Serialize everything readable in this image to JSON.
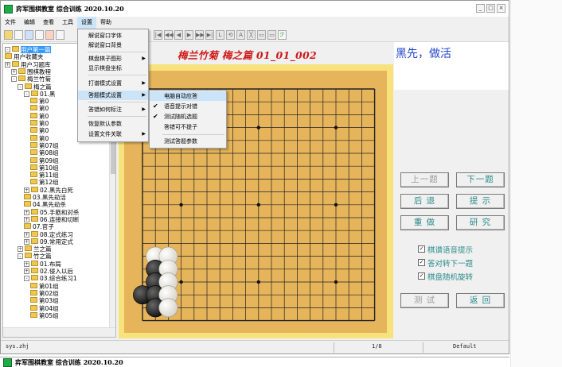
{
  "window": {
    "title": "弈军围棋教室 综合训练 2020.10.20",
    "controls": [
      "_",
      "□",
      "×"
    ]
  },
  "menubar": {
    "items": [
      "文件",
      "编辑",
      "查看",
      "工具",
      "设置",
      "帮助"
    ],
    "active_index": 4
  },
  "settings_menu": {
    "items": [
      {
        "label": "解说窗口字体",
        "submenu": false
      },
      {
        "label": "解说窗口背景",
        "submenu": false
      },
      {
        "label": "棋盘棋子图形",
        "submenu": true
      },
      {
        "label": "显示棋盘坐标",
        "submenu": false
      },
      {
        "label": "打谱模式设置",
        "submenu": true
      },
      {
        "label": "答题模式设置",
        "submenu": true
      },
      {
        "label": "答错如何标注",
        "submenu": true
      },
      {
        "label": "恢复默认参数",
        "submenu": false
      },
      {
        "label": "设置文件关联",
        "submenu": true
      }
    ],
    "highlighted_index": 5
  },
  "answer_submenu": {
    "items": [
      {
        "label": "电脑自动应答",
        "checked": false
      },
      {
        "label": "语音提示对错",
        "checked": true
      },
      {
        "label": "测试随机选题",
        "checked": true
      },
      {
        "label": "答错可不提子",
        "checked": false
      },
      {
        "label": "测试答题参数",
        "checked": false
      }
    ],
    "highlighted_index": 0
  },
  "tree": {
    "items": [
      {
        "label": "用户第一篇",
        "selected": true
      },
      {
        "label": "用户收藏夹",
        "selected": false
      },
      {
        "label": "用户习题库",
        "selected": false
      },
      {
        "label": "围棋教程",
        "selected": false
      },
      {
        "label": "梅兰竹菊",
        "selected": false
      },
      {
        "label": "梅之篇",
        "selected": false
      },
      {
        "label": "01.黑",
        "selected": false
      },
      {
        "label": "第0",
        "selected": false
      },
      {
        "label": "第0",
        "selected": false
      },
      {
        "label": "第0",
        "selected": false
      },
      {
        "label": "第0",
        "selected": false
      },
      {
        "label": "第0",
        "selected": false
      },
      {
        "label": "第0",
        "selected": false
      },
      {
        "label": "第07组",
        "selected": false
      },
      {
        "label": "第08组",
        "selected": false
      },
      {
        "label": "第09组",
        "selected": false
      },
      {
        "label": "第10组",
        "selected": false
      },
      {
        "label": "第11组",
        "selected": false
      },
      {
        "label": "第12组",
        "selected": false
      },
      {
        "label": "02.黑先白死",
        "selected": false
      },
      {
        "label": "03.黑先劫活",
        "selected": false
      },
      {
        "label": "04.黑先劫杀",
        "selected": false
      },
      {
        "label": "05.手筋和对杀",
        "selected": false
      },
      {
        "label": "06.连接和切断",
        "selected": false
      },
      {
        "label": "07.官子",
        "selected": false
      },
      {
        "label": "08.定式练习",
        "selected": false
      },
      {
        "label": "09.常用定式",
        "selected": false
      },
      {
        "label": "兰之篇",
        "selected": false
      },
      {
        "label": "竹之篇",
        "selected": false
      },
      {
        "label": "01.布局",
        "selected": false
      },
      {
        "label": "02.侵入以后",
        "selected": false
      },
      {
        "label": "03.综合练习1",
        "selected": false
      },
      {
        "label": "第01组",
        "selected": false
      },
      {
        "label": "第02组",
        "selected": false
      },
      {
        "label": "第03组",
        "selected": false
      },
      {
        "label": "第04组",
        "selected": false
      },
      {
        "label": "第05组",
        "selected": false
      }
    ]
  },
  "problem": {
    "title": "梅兰竹菊 梅之篇 01_01_002",
    "status": "黑先，做活"
  },
  "stones": [
    {
      "col": 1,
      "row": 13,
      "color": "white"
    },
    {
      "col": 2,
      "row": 13,
      "color": "white"
    },
    {
      "col": 1,
      "row": 14,
      "color": "black"
    },
    {
      "col": 2,
      "row": 14,
      "color": "white"
    },
    {
      "col": 1,
      "row": 15,
      "color": "black"
    },
    {
      "col": 2,
      "row": 15,
      "color": "white"
    },
    {
      "col": 0,
      "row": 16,
      "color": "black"
    },
    {
      "col": 1,
      "row": 16,
      "color": "black"
    },
    {
      "col": 2,
      "row": 16,
      "color": "white"
    },
    {
      "col": 1,
      "row": 17,
      "color": "black"
    },
    {
      "col": 2,
      "row": 17,
      "color": "white"
    }
  ],
  "buttons": {
    "prev": "上一题",
    "next": "下一题",
    "back": "后 退",
    "hint": "提 示",
    "redo": "重 做",
    "study": "研 究",
    "test": "测 试",
    "return": "返 回"
  },
  "options": [
    {
      "label": "棋谱语音提示",
      "checked": true
    },
    {
      "label": "答对转下一题",
      "checked": true
    },
    {
      "label": "棋盘随机旋转",
      "checked": true
    }
  ],
  "statusbar": {
    "file": "sys.zhj",
    "page": "1/8",
    "style": "Default"
  },
  "second_window": {
    "title": "弈军围棋教室 综合训练 2020.10.20"
  },
  "colors": {
    "board_frame": "#f8e27c",
    "board_wood": "#e6b45a",
    "problem_title": "#d01818",
    "status_text": "#2244cc",
    "button_text": "#2b8a8a"
  }
}
